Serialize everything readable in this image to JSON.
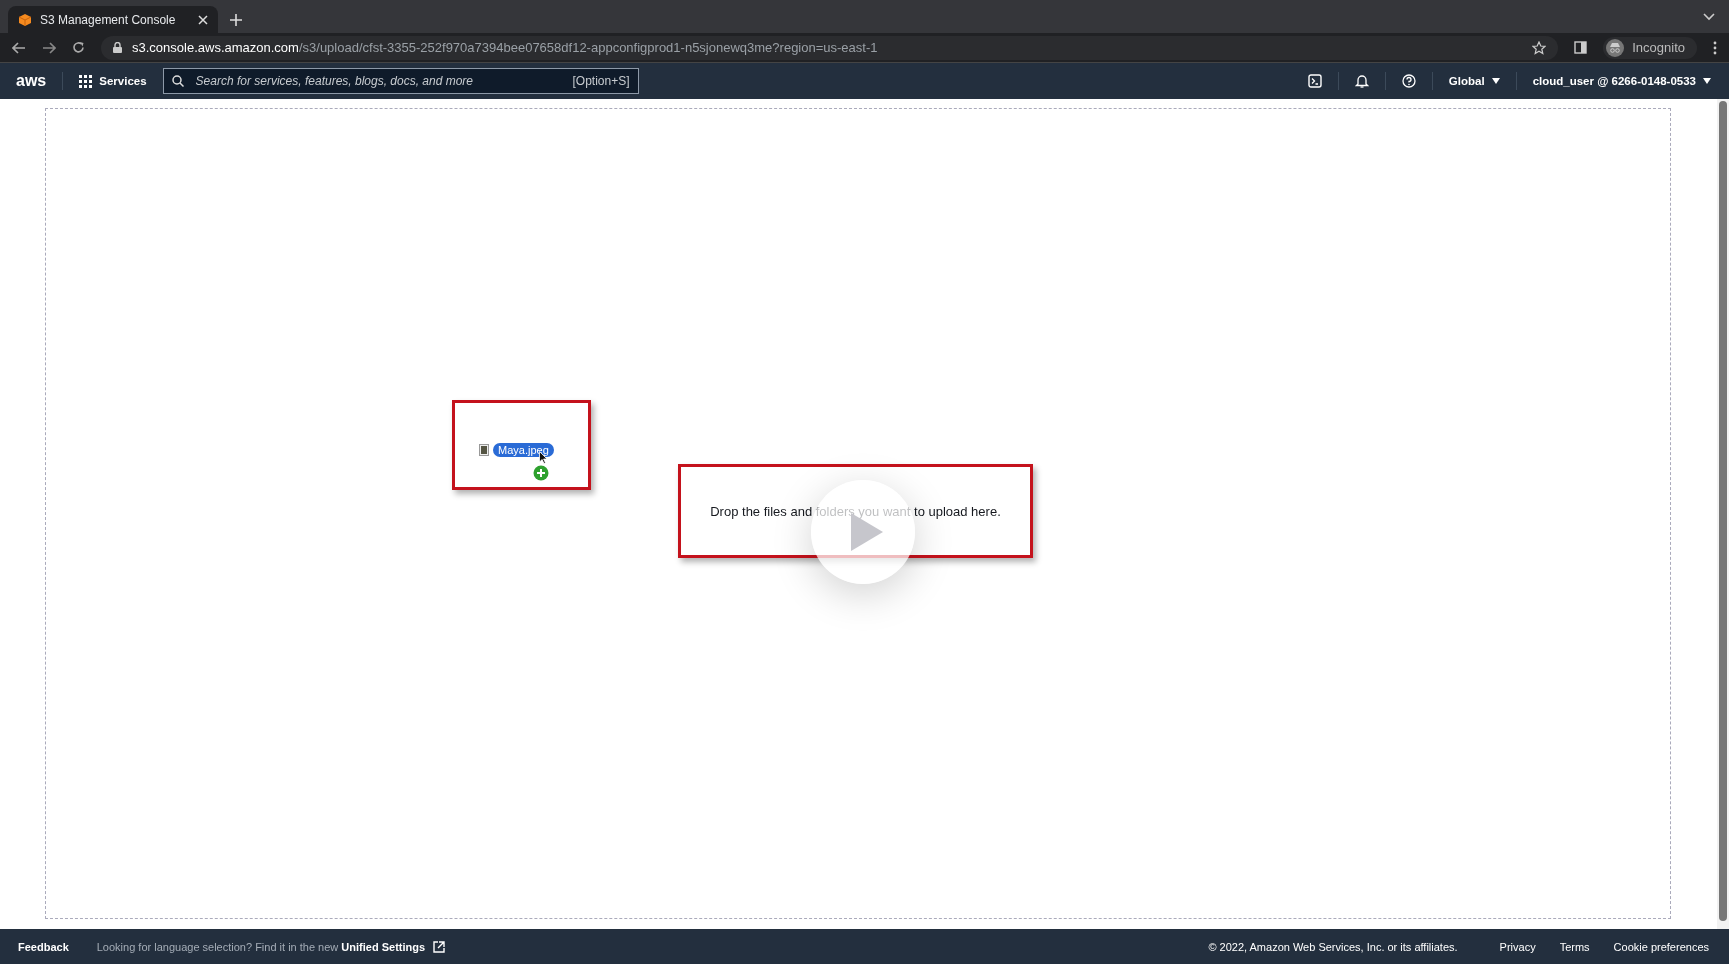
{
  "browser": {
    "tab": {
      "title": "S3 Management Console"
    },
    "address_bar": {
      "host": "s3.console.aws.amazon.com",
      "path": "/s3/upload/cfst-3355-252f970a7394bee07658df12-appconfigprod1-n5sjonewq3me?region=us-east-1"
    },
    "profile": "Incognito"
  },
  "nav": {
    "logo": "aws",
    "services": "Services",
    "search": {
      "placeholder": "Search for services, features, blogs, docs, and more",
      "shortcut": "[Option+S]"
    },
    "region": "Global",
    "account": "cloud_user @ 6266-0148-0533"
  },
  "drop_zone": {
    "message": "Drop the files and folders you want to upload here.",
    "dragged_file": "Maya.jpeg"
  },
  "footer": {
    "feedback": "Feedback",
    "notice": "Looking for language selection? Find it in the new",
    "notice_link": "Unified Settings",
    "copyright": "© 2022, Amazon Web Services, Inc. or its affiliates.",
    "links": [
      "Privacy",
      "Terms",
      "Cookie preferences"
    ]
  }
}
